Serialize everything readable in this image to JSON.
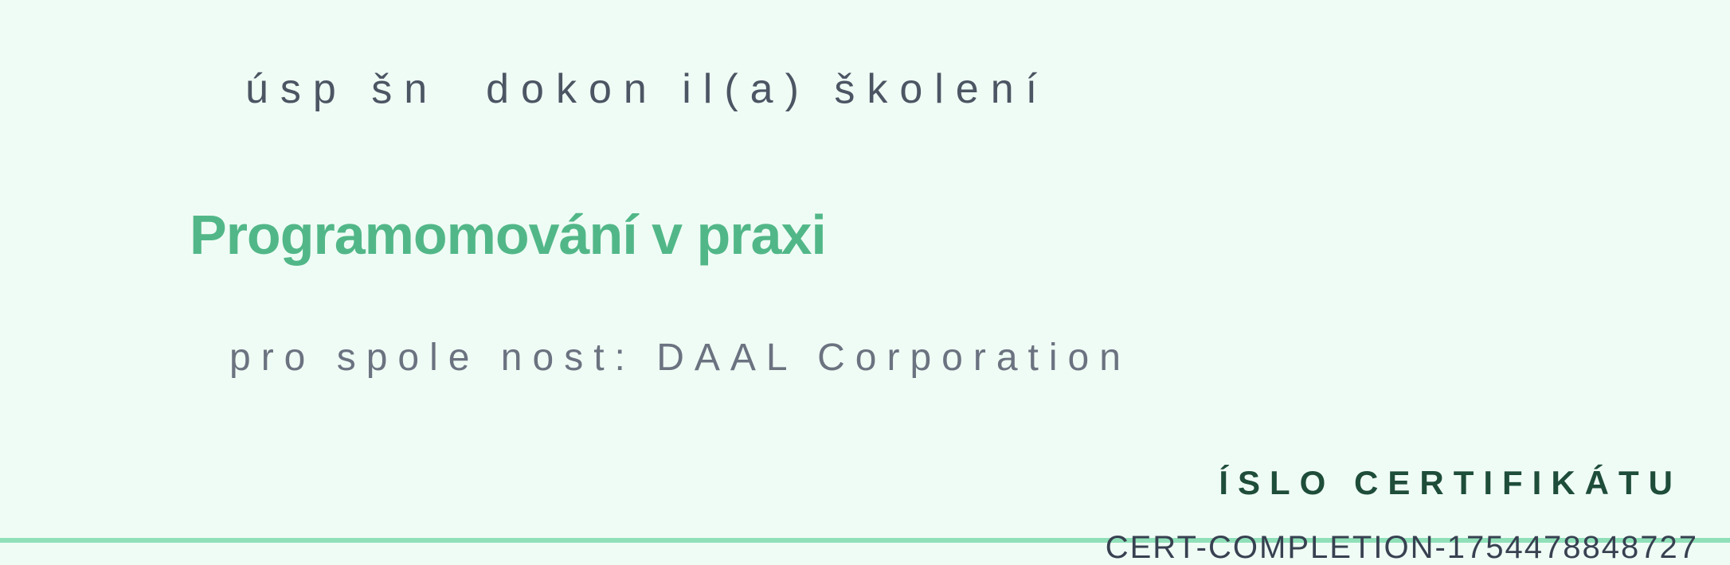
{
  "certificate": {
    "intro_text": "úsp šn  dokon il(a) školení",
    "course_title": "Programomování v praxi",
    "company_line": "pro spole nost: DAAL Corporation",
    "number_label": "ÍSLO CERTIFIKÁTU",
    "number_value": "CERT-COMPLETION-1754478848727"
  },
  "colors": {
    "background": "#effcf5",
    "accent": "#52b788",
    "heading_dark": "#1e4d3a",
    "text_gray": "#4b5563",
    "bottom_rule": "#8fe0b8"
  }
}
